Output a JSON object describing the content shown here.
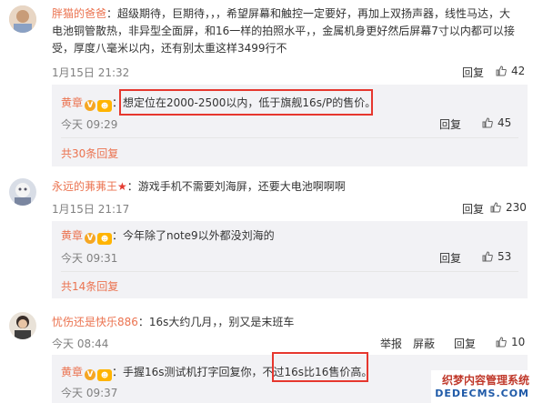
{
  "comments": [
    {
      "name": "胖猫的爸爸",
      "text_line1": "：超级期待，巨期待，，，希望屏幕和触控一定要好，再加上双扬声器，线性马达，大",
      "text_line2": "电池铜管散热，非异型全面屏，和16一样的拍照水平，，金属机身更好然后屏幕7寸以内都可以接",
      "text_line3": "受，厚度八毫米以内，还有别太重这样3499行不",
      "time": "1月15日 21:32",
      "reply_label": "回复",
      "likes": "42",
      "reply": {
        "name": "黄章",
        "text": "：想定位在2000-2500以内，低于旗舰16s/P的售价。",
        "time": "今天 09:29",
        "reply_label": "回复",
        "likes": "45"
      },
      "more": "共30条回复"
    },
    {
      "name": "永远的茀茀王",
      "text": "：游戏手机不需要刘海屏，还要大电池啊啊啊",
      "time": "1月15日 21:17",
      "reply_label": "回复",
      "likes": "230",
      "reply": {
        "name": "黄章",
        "text": "：今年除了note9以外都没刘海的",
        "time": "今天 09:31",
        "reply_label": "回复",
        "likes": "53"
      },
      "more": "共14条回复"
    },
    {
      "name": "忧伤还是快乐886",
      "text": "：16s大约几月，，别又是末班车",
      "time": "今天 08:44",
      "report_label": "举报",
      "pin_label": "屏蔽",
      "reply_label": "回复",
      "likes": "10",
      "reply": {
        "name": "黄章",
        "text": "：手握16s测试机打字回复你，不过16s比16售价高。",
        "time": "今天 09:37"
      }
    }
  ],
  "watermark": {
    "line1": "织梦内容管理系统",
    "line2": "DEDECMS.COM"
  },
  "colors": {
    "name": "#eb7350",
    "highlight_box": "#e6372e",
    "reply_bg": "#f2f2f5"
  }
}
